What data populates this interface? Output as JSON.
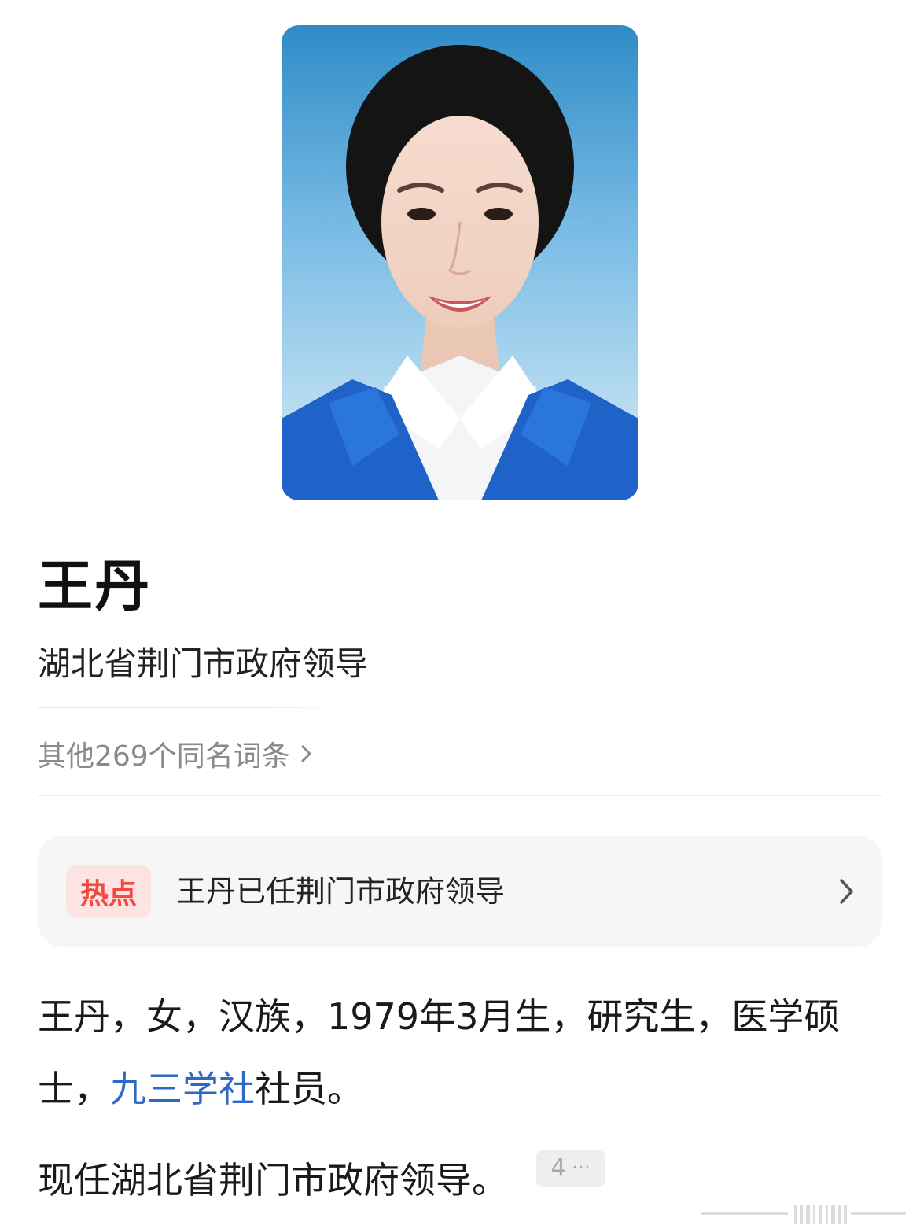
{
  "profile": {
    "name": "王丹",
    "subtitle": "湖北省荆门市政府领导",
    "photo_icon": "portrait-photo"
  },
  "other_entries": {
    "label": "其他269个同名词条",
    "icon": "chevron-right-icon"
  },
  "hot": {
    "badge": "热点",
    "text": "王丹已任荆门市政府领导",
    "icon": "chevron-right-icon"
  },
  "intro": {
    "para1_before": "王丹，女，汉族，1979年3月生，研究生，医学硕士，",
    "para1_link": "九三学社",
    "para1_after": "社员。",
    "para2": "现任湖北省荆门市政府领导。",
    "citation_number": "4",
    "citation_more": "···"
  },
  "colors": {
    "link": "#2f69c6",
    "hot_badge_text": "#ee4b43",
    "hot_badge_bg": "#fde4e2",
    "muted_text": "#8a8a8a"
  }
}
